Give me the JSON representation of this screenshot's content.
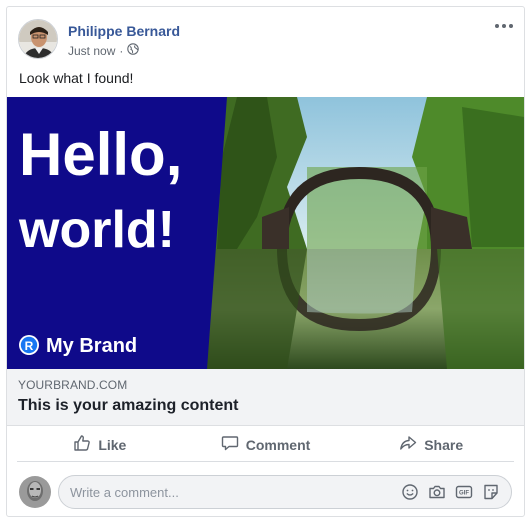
{
  "post": {
    "author": "Philippe Bernard",
    "timestamp": "Just now",
    "separator": "·",
    "privacy_icon": "globe-icon",
    "text": "Look what I found!"
  },
  "preview": {
    "headline_line1": "Hello,",
    "headline_line2": "world!",
    "brand_badge": "R",
    "brand_name": "My Brand",
    "panel_color": "#0f0a8a"
  },
  "link": {
    "domain": "YOURBRAND.COM",
    "title": "This is your amazing content"
  },
  "actions": [
    {
      "label": "Like",
      "icon": "thumbs-up-icon"
    },
    {
      "label": "Comment",
      "icon": "comment-icon"
    },
    {
      "label": "Share",
      "icon": "share-icon"
    }
  ],
  "comment": {
    "placeholder": "Write a comment...",
    "icons": [
      "emoji-icon",
      "camera-icon",
      "gif-icon",
      "sticker-icon"
    ]
  },
  "colors": {
    "author_link": "#385898",
    "secondary_text": "#606770",
    "link_bg": "#f2f3f5"
  }
}
